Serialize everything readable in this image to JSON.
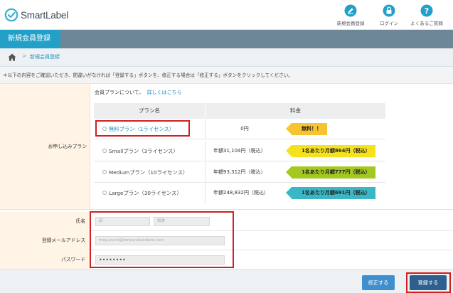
{
  "app": {
    "name": "SmartLabel",
    "brand_color": "#3ab0d0"
  },
  "header": {
    "nav": [
      {
        "label": "新規会員登録",
        "icon": "edit-icon"
      },
      {
        "label": "ログイン",
        "icon": "lock-icon"
      },
      {
        "label": "よくあるご質問",
        "icon": "help-icon"
      }
    ]
  },
  "page_title": "新規会員登録",
  "breadcrumb": {
    "sep": ">",
    "current": "新規会員登録"
  },
  "notice": "＊以下の内容をご確認いただき、間違いがなければ「登録する」ボタンを、修正する場合は「修正する」ボタンをクリックしてください。",
  "plan": {
    "label": "お申し込みプラン",
    "intro": "会員プランについて、",
    "intro_link": "詳しくはこちら",
    "col_name": "プラン名",
    "col_fee": "料金",
    "rows": [
      {
        "name": "無料プラン（1ライセンス）",
        "price": "0円",
        "tag": "無料！！",
        "tag_color": "#f6c331",
        "selected": true
      },
      {
        "name": "Smallプラン（3ライセンス）",
        "price": "年額31,104円（税込）",
        "tag": "1名あたり月額864円（税込）",
        "tag_color": "#f6e21c",
        "selected": false
      },
      {
        "name": "Mediumプラン（10ライセンス）",
        "price": "年額93,312円（税込）",
        "tag": "1名あたり月額777円（税込）",
        "tag_color": "#a4c81f",
        "selected": false
      },
      {
        "name": "Largeプラン（30ライセンス）",
        "price": "年額248,832円（税込）",
        "tag": "1名あたり月額691円（税込）",
        "tag_color": "#3bb6c4",
        "selected": false
      }
    ]
  },
  "form": {
    "name_label": "氏名",
    "last_name": "田",
    "first_name": "知美",
    "email_label": "登録メールアドレス",
    "email": "mayuzumi@tomoyukasaiam.com",
    "password_label": "パスワード",
    "password": "••••••••"
  },
  "buttons": {
    "edit": "修正する",
    "submit": "登録する"
  }
}
